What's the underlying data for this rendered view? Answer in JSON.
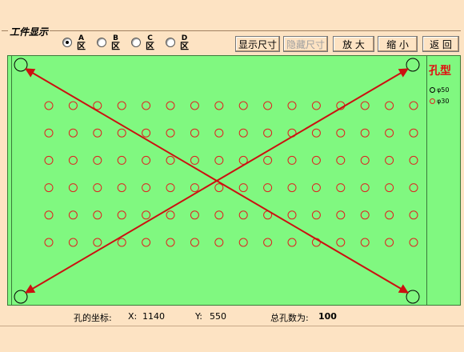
{
  "group_title": "工件显示",
  "radios": [
    {
      "top": "A",
      "bottom": "区",
      "selected": true
    },
    {
      "top": "B",
      "bottom": "区",
      "selected": false
    },
    {
      "top": "C",
      "bottom": "区",
      "selected": false
    },
    {
      "top": "D",
      "bottom": "区",
      "selected": false
    }
  ],
  "buttons": {
    "show_dim": "显示尺寸",
    "hide_dim": "隐藏尺寸",
    "zoom_in": "放 大",
    "zoom_out": "缩 小",
    "back": "返 回"
  },
  "panel": {
    "title": "孔型",
    "legend": [
      {
        "label": "φ50",
        "color": "#000000"
      },
      {
        "label": "φ30",
        "color": "#e02020"
      }
    ]
  },
  "grid": {
    "columns": 16,
    "rows": 6
  },
  "status": {
    "coord_label": "孔的坐标:",
    "x_label": "X:",
    "x_value": "1140",
    "y_label": "Y:",
    "y_value": "550",
    "total_label": "总孔数为:",
    "total_value": "100"
  },
  "colors": {
    "canvas": "#80f880",
    "hole": "#e02020",
    "arrow": "#cc1010",
    "bg": "#fde3c3"
  }
}
